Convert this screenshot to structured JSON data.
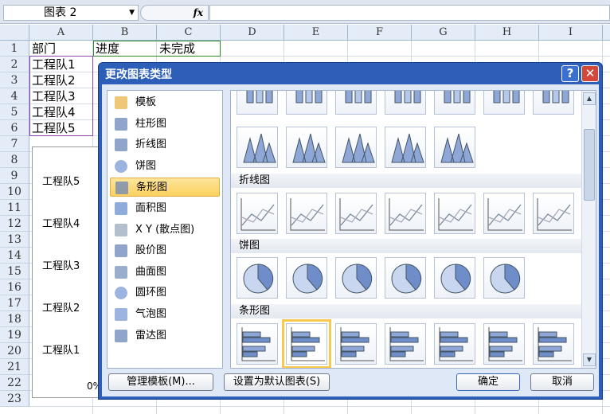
{
  "formula_bar": {
    "name_box": "图表 2",
    "fx": "fx",
    "formula": ""
  },
  "columns": [
    "A",
    "B",
    "C",
    "D",
    "E",
    "F",
    "G",
    "H",
    "I"
  ],
  "rows": [
    "1",
    "2",
    "3",
    "4",
    "5",
    "6",
    "7",
    "8",
    "9",
    "10",
    "11",
    "12",
    "13",
    "14",
    "15",
    "16",
    "17",
    "18",
    "19",
    "20",
    "21",
    "22",
    "23"
  ],
  "cells": {
    "A1": "部门",
    "B1": "进度",
    "C1": "未完成",
    "A2": "工程队1",
    "A3": "工程队2",
    "A4": "工程队3",
    "A5": "工程队4",
    "A6": "工程队5"
  },
  "chart": {
    "labels": [
      "工程队5",
      "工程队4",
      "工程队3",
      "工程队2",
      "工程队1"
    ],
    "axis_tick": "0%"
  },
  "dialog": {
    "title": "更改图表类型",
    "help": "?",
    "close": "✕",
    "categories": [
      {
        "label": "模板",
        "icon": "folder-icon"
      },
      {
        "label": "柱形图",
        "icon": "column-chart-icon"
      },
      {
        "label": "折线图",
        "icon": "line-chart-icon"
      },
      {
        "label": "饼图",
        "icon": "pie-chart-icon"
      },
      {
        "label": "条形图",
        "icon": "bar-chart-icon",
        "selected": true
      },
      {
        "label": "面积图",
        "icon": "area-chart-icon"
      },
      {
        "label": "X Y (散点图)",
        "icon": "scatter-chart-icon"
      },
      {
        "label": "股价图",
        "icon": "stock-chart-icon"
      },
      {
        "label": "曲面图",
        "icon": "surface-chart-icon"
      },
      {
        "label": "圆环图",
        "icon": "doughnut-chart-icon"
      },
      {
        "label": "气泡图",
        "icon": "bubble-chart-icon"
      },
      {
        "label": "雷达图",
        "icon": "radar-chart-icon"
      }
    ],
    "sections": {
      "line": "折线图",
      "pie": "饼图",
      "bar": "条形图"
    },
    "buttons": {
      "manage": "管理模板(M)...",
      "set_default": "设置为默认图表(S)",
      "ok": "确定",
      "cancel": "取消"
    }
  }
}
